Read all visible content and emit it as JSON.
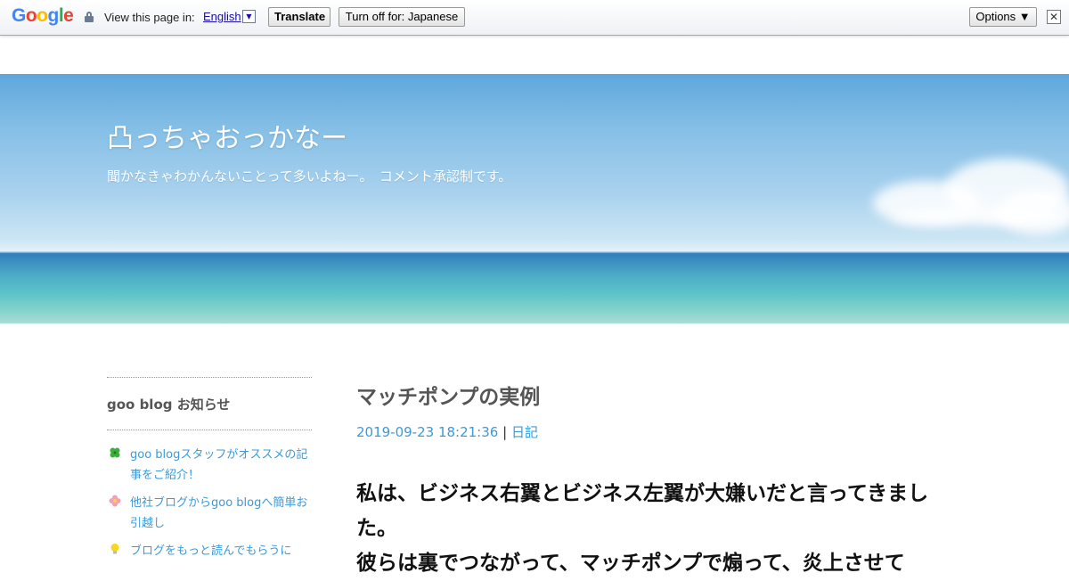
{
  "translate_bar": {
    "logo": [
      "G",
      "o",
      "o",
      "g",
      "l",
      "e"
    ],
    "view_label": "View this page in:",
    "language": "English",
    "language_arrow": "▼",
    "translate_button": "Translate",
    "turn_off_button": "Turn off for: Japanese",
    "options_button": "Options ▼",
    "close_button": "✕"
  },
  "header": {
    "title": "凸っちゃおっかなー",
    "description": "聞かなきゃわかんないことって多いよねー。　コメント承認制です。"
  },
  "sidebar": {
    "heading": "goo blog お知らせ",
    "items": [
      {
        "icon": "clover-icon",
        "label": "goo blogスタッフがオススメの記事をご紹介！"
      },
      {
        "icon": "flower-icon",
        "label": "他社ブログからgoo blogへ簡単お引越し"
      },
      {
        "icon": "lightbulb-icon",
        "label": "ブログをもっと読んでもらうに"
      }
    ]
  },
  "post": {
    "title": "マッチポンプの実例",
    "date": "2019-09-23 18:21:36",
    "separator": "|",
    "category": "日記",
    "body_lines": [
      "私は、ビジネス右翼とビジネス左翼が大嫌いだと言ってきました。",
      "彼らは裏でつながって、マッチポンプで煽って、炎上させて"
    ]
  },
  "colors": {
    "link": "#3b9ad9",
    "title_gray": "#555555"
  }
}
